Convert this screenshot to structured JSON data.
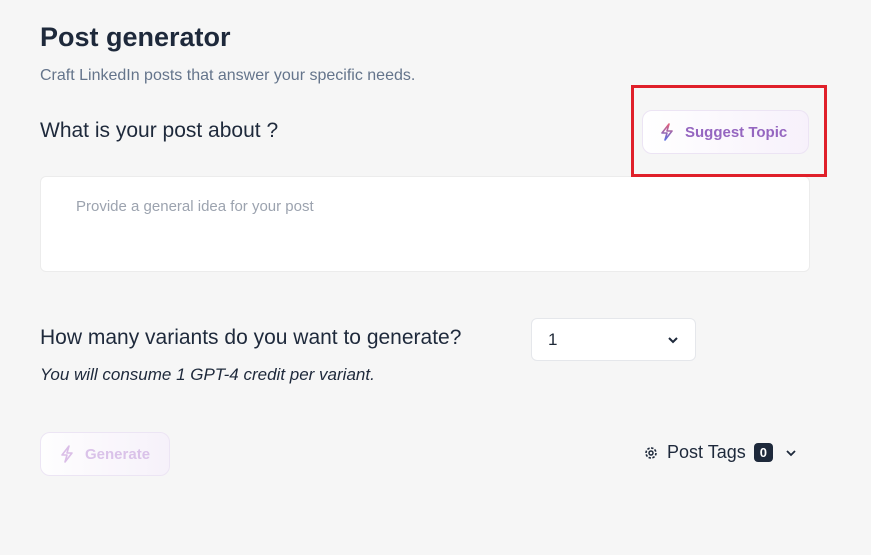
{
  "header": {
    "title": "Post generator",
    "subtitle": "Craft LinkedIn posts that answer your specific needs."
  },
  "topic": {
    "question": "What is your post about ?",
    "suggest_label": "Suggest Topic",
    "placeholder": "Provide a general idea for your post",
    "value": ""
  },
  "variants": {
    "question": "How many variants do you want to generate?",
    "selected": "1",
    "note": "You will consume 1 GPT-4 credit per variant."
  },
  "actions": {
    "generate_label": "Generate",
    "post_tags_label": "Post Tags",
    "post_tags_count": "0"
  },
  "colors": {
    "accent": "#9566c0",
    "annotation": "#e0202a",
    "badge": "#1e293b"
  },
  "icons": {
    "suggest": "lightning-icon",
    "generate": "lightning-icon",
    "tags": "gear-icon",
    "select": "chevron-down-icon",
    "tags_toggle": "chevron-down-icon"
  }
}
